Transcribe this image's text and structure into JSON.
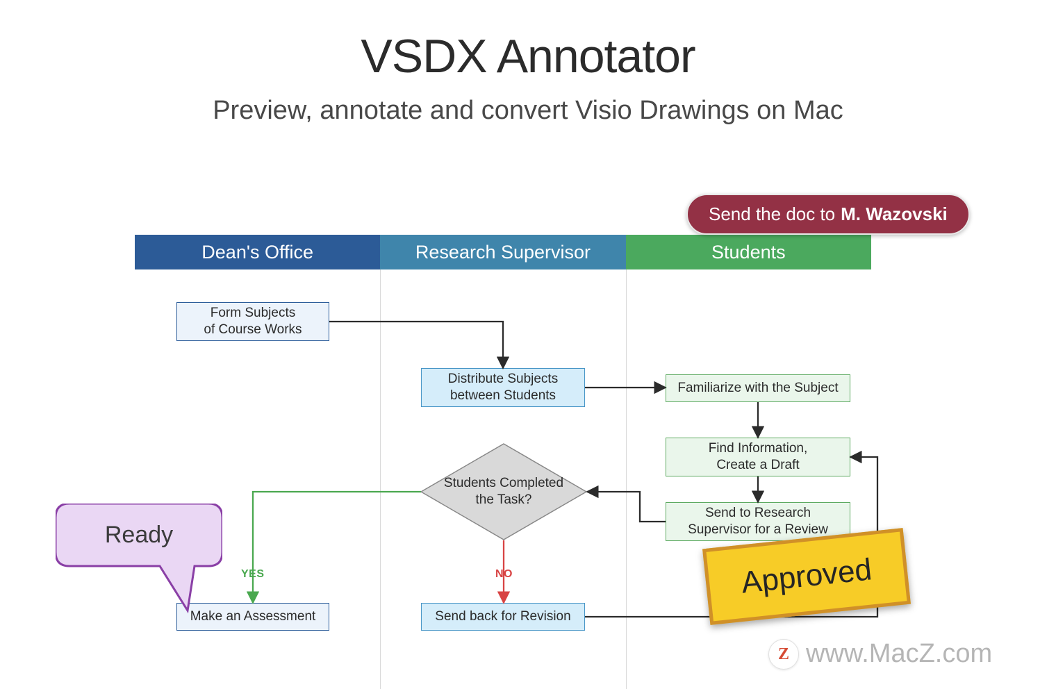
{
  "title": "VSDX Annotator",
  "subtitle": "Preview, annotate and convert Visio Drawings on Mac",
  "lanes": {
    "deans_office": "Dean's Office",
    "research_supervisor": "Research Supervisor",
    "students": "Students"
  },
  "nodes": {
    "form_subjects": "Form Subjects\nof Course Works",
    "distribute": "Distribute Subjects\nbetween Students",
    "familiarize": "Familiarize with the Subject",
    "find_info": "Find Information,\nCreate a Draft",
    "send_review": "Send to Research\nSupervisor for a Review",
    "decision": "Students Completed the Task?",
    "assessment": "Make an Assessment",
    "send_back": "Send back for Revision"
  },
  "edge_labels": {
    "yes": "YES",
    "no": "NO"
  },
  "annotations": {
    "pill_prefix": "Send the doc to",
    "pill_bold": "M. Wazovski",
    "sticky": "Approved",
    "speech": "Ready"
  },
  "watermark": {
    "z": "Z",
    "text": "www.MacZ.com"
  }
}
